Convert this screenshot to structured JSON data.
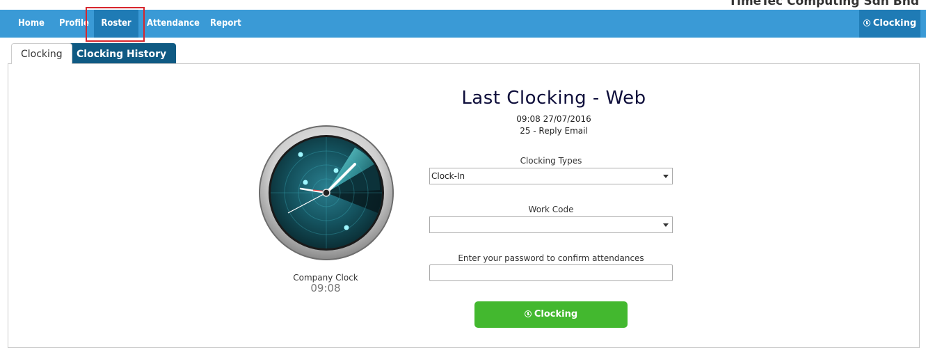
{
  "company": {
    "name": "TimeTec Computing Sdn Bhd"
  },
  "nav": {
    "items": [
      {
        "label": "Home"
      },
      {
        "label": "Profile"
      },
      {
        "label": "Roster"
      },
      {
        "label": "Attendance"
      },
      {
        "label": "Report"
      }
    ],
    "active": "Roster",
    "right_label": "Clocking",
    "right_icon": "clock-icon"
  },
  "tabs": [
    {
      "label": "Clocking",
      "selected": true
    },
    {
      "label": "Clocking History",
      "selected": false
    }
  ],
  "clock": {
    "caption": "Company Clock",
    "time": "09:08",
    "icon": "radar-clock-icon"
  },
  "last_clocking": {
    "title": "Last Clocking - Web",
    "datetime": "09:08 27/07/2016",
    "detail": "25 - Reply Email"
  },
  "form": {
    "clocking_types_label": "Clocking Types",
    "clocking_types_value": "Clock-In",
    "work_code_label": "Work Code",
    "work_code_value": "",
    "password_label": "Enter your password to confirm attendances",
    "password_value": "",
    "submit_label": "Clocking",
    "submit_icon": "clock-icon"
  },
  "colors": {
    "navbar": "#3a9ad6",
    "nav_active": "#1f7bb5",
    "highlight_box": "#d7262d",
    "tab_history": "#0f5a83",
    "button": "#43b82f",
    "title": "#0d0d3a"
  }
}
